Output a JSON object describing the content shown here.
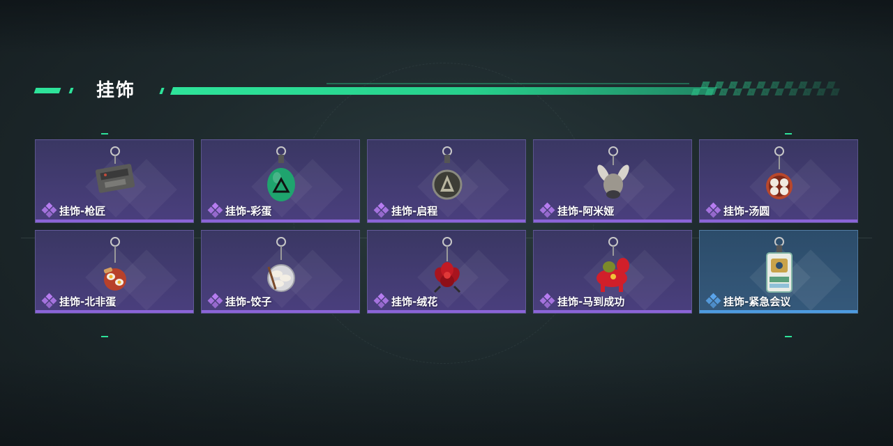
{
  "section": {
    "title": "挂饰"
  },
  "colors": {
    "accent": "#2ee39a",
    "epic": "#8b64d8",
    "rare": "#4d9be0"
  },
  "items": [
    {
      "label": "挂饰-枪匠",
      "rarity": "epic",
      "icon": "gunsmith-charm-icon"
    },
    {
      "label": "挂饰-彩蛋",
      "rarity": "epic",
      "icon": "easter-egg-charm-icon"
    },
    {
      "label": "挂饰-启程",
      "rarity": "epic",
      "icon": "departure-charm-icon"
    },
    {
      "label": "挂饰-阿米娅",
      "rarity": "epic",
      "icon": "amiya-charm-icon"
    },
    {
      "label": "挂饰-汤圆",
      "rarity": "epic",
      "icon": "tangyuan-charm-icon"
    },
    {
      "label": "挂饰-北非蛋",
      "rarity": "epic",
      "icon": "shakshuka-charm-icon"
    },
    {
      "label": "挂饰-饺子",
      "rarity": "epic",
      "icon": "dumpling-charm-icon"
    },
    {
      "label": "挂饰-绒花",
      "rarity": "epic",
      "icon": "velvet-flower-charm-icon"
    },
    {
      "label": "挂饰-马到成功",
      "rarity": "epic",
      "icon": "horse-success-charm-icon"
    },
    {
      "label": "挂饰-紧急会议",
      "rarity": "rare",
      "icon": "emergency-meeting-charm-icon"
    }
  ]
}
